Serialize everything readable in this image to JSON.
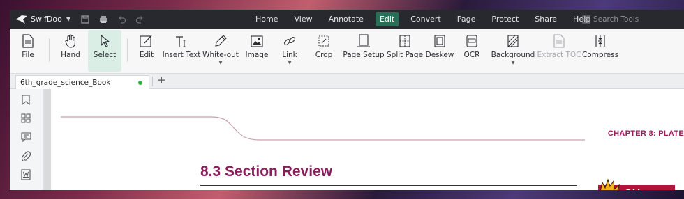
{
  "app": {
    "name": "SwifDoo"
  },
  "menu": {
    "items": [
      "Home",
      "View",
      "Annotate",
      "Edit",
      "Convert",
      "Page",
      "Protect",
      "Share",
      "Help"
    ],
    "active": "Edit",
    "search_placeholder": "Search Tools"
  },
  "ribbon": {
    "tools": [
      {
        "label": "File",
        "icon": "file-icon"
      },
      {
        "label": "Hand",
        "icon": "hand-icon"
      },
      {
        "label": "Select",
        "icon": "cursor-icon",
        "selected": true
      },
      {
        "label": "Edit",
        "icon": "edit-icon"
      },
      {
        "label": "Insert Text",
        "icon": "insert-text-icon"
      },
      {
        "label": "White-out",
        "icon": "whiteout-icon",
        "dropdown": true
      },
      {
        "label": "Image",
        "icon": "image-icon"
      },
      {
        "label": "Link",
        "icon": "link-icon",
        "dropdown": true
      },
      {
        "label": "Crop",
        "icon": "crop-icon"
      },
      {
        "label": "Page Setup",
        "icon": "page-setup-icon"
      },
      {
        "label": "Split Page",
        "icon": "split-page-icon"
      },
      {
        "label": "Deskew",
        "icon": "deskew-icon"
      },
      {
        "label": "OCR",
        "icon": "ocr-icon"
      },
      {
        "label": "Background",
        "icon": "background-icon",
        "dropdown": true
      },
      {
        "label": "Extract TOC",
        "icon": "extract-toc-icon",
        "disabled": true
      },
      {
        "label": "Compress",
        "icon": "compress-icon"
      }
    ]
  },
  "tabs": {
    "open": [
      {
        "label": "6th_grade_science_Book",
        "status_color": "#2db24a"
      }
    ],
    "add_label": "+"
  },
  "document": {
    "chapter_header": "CHAPTER 8: PLATE",
    "section_title": "8.3 Section Review",
    "badge_text": "CH"
  },
  "colors": {
    "accent": "#2a6e57",
    "titlebar": "#27292e",
    "heading": "#8a1e5c",
    "header_line": "#c9a0ad"
  }
}
